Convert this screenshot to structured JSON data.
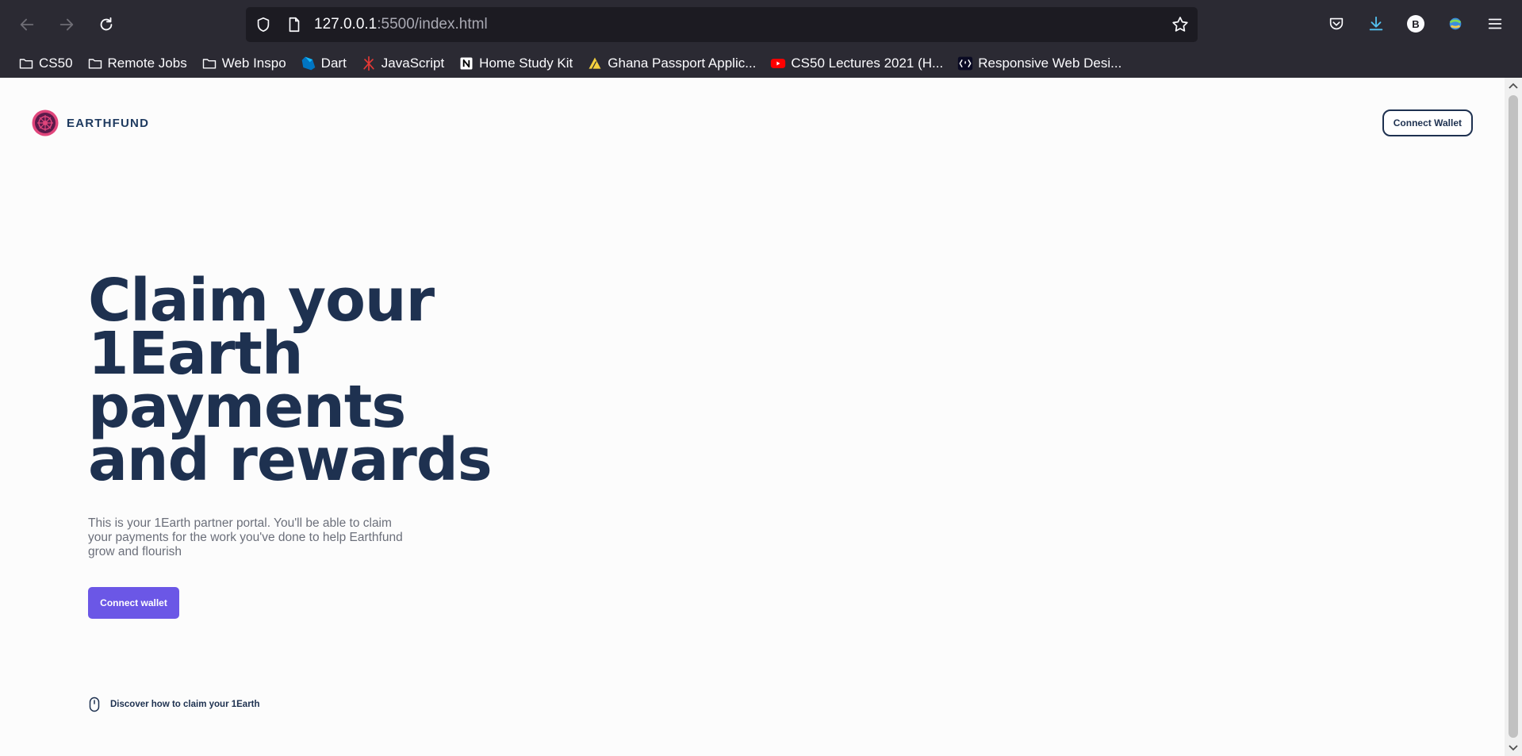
{
  "browser": {
    "url_host": "127.0.0.1",
    "url_rest": ":5500/index.html",
    "profile_initial": "B",
    "bookmarks": [
      {
        "label": "CS50",
        "icon": "folder-icon"
      },
      {
        "label": "Remote Jobs",
        "icon": "folder-icon"
      },
      {
        "label": "Web Inspo",
        "icon": "folder-icon"
      },
      {
        "label": "Dart",
        "icon": "dart-logo-icon"
      },
      {
        "label": "JavaScript",
        "icon": "javascript-logo-icon"
      },
      {
        "label": "Home Study Kit",
        "icon": "notion-logo-icon"
      },
      {
        "label": "Ghana Passport Applic...",
        "icon": "passport-logo-icon"
      },
      {
        "label": "CS50 Lectures 2021 (H...",
        "icon": "youtube-logo-icon"
      },
      {
        "label": "Responsive Web Desi...",
        "icon": "freecodecamp-logo-icon"
      }
    ]
  },
  "site": {
    "brand": "EARTHFUND",
    "header_button": "Connect Wallet",
    "hero_lines": [
      "Claim your",
      "1Earth",
      "payments",
      "and rewards"
    ],
    "description": "This is your 1Earth partner portal. You'll be able to claim your payments for the work you've done to help Earthfund grow and flourish",
    "cta_button": "Connect wallet",
    "discover_text": "Discover how to claim your 1Earth"
  },
  "colors": {
    "chrome_bg": "#2b2a33",
    "urlbar_bg": "#1c1b22",
    "heading": "#1e3150",
    "accent": "#6b57e6",
    "muted_text": "#6b6f7a"
  }
}
